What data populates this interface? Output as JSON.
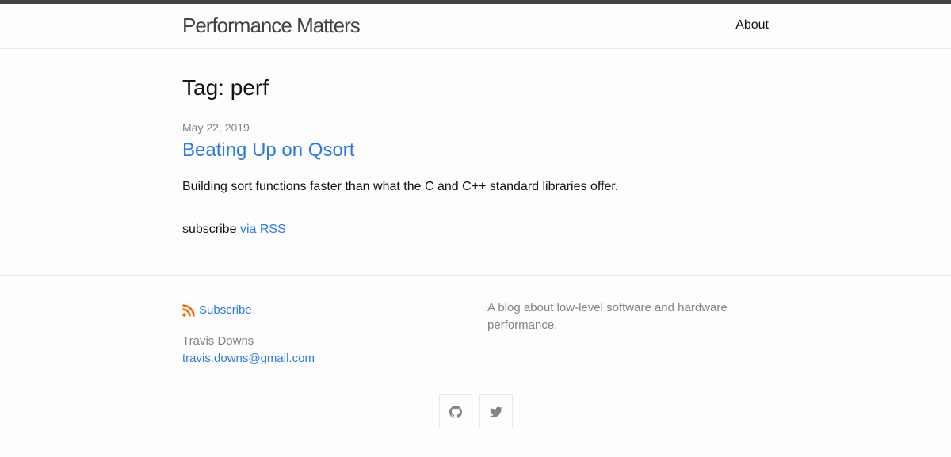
{
  "header": {
    "site_title": "Performance Matters",
    "nav": [
      {
        "label": "About"
      }
    ]
  },
  "page": {
    "heading": "Tag: perf",
    "posts": [
      {
        "date": "May 22, 2019",
        "title": "Beating Up on Qsort",
        "excerpt": "Building sort functions faster than what the C and C++ standard libraries offer."
      }
    ],
    "rss_prefix": "subscribe",
    "rss_link": "via RSS"
  },
  "footer": {
    "subscribe_label": "Subscribe",
    "author_name": "Travis Downs",
    "author_email": "travis.downs@gmail.com",
    "description": "A blog about low-level software and hardware performance.",
    "social": [
      {
        "icon": "github-icon"
      },
      {
        "icon": "twitter-icon"
      }
    ]
  },
  "colors": {
    "link": "#2a7ae2",
    "topbar": "#424242",
    "rss_orange": "#ef6c00",
    "muted": "#828282"
  }
}
